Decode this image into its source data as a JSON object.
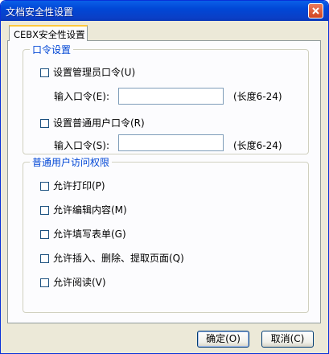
{
  "window": {
    "title": "文档安全性设置"
  },
  "tab": {
    "label": "CEBX安全性设置"
  },
  "password_group": {
    "legend": "口令设置",
    "admin_checkbox": "设置管理员口令(U)",
    "admin_input_label": "输入口令(E):",
    "admin_hint": "(长度6-24)",
    "user_checkbox": "设置普通用户口令(R)",
    "user_input_label": "输入口令(S):",
    "user_hint": "(长度6-24)"
  },
  "permissions_group": {
    "legend": "普通用户访问权限",
    "items": [
      "允许打印(P)",
      "允许编辑内容(M)",
      "允许填写表单(G)",
      "允许插入、删除、提取页面(Q)",
      "允许阅读(V)"
    ]
  },
  "buttons": {
    "ok": "确定(O)",
    "cancel": "取消(C)"
  }
}
